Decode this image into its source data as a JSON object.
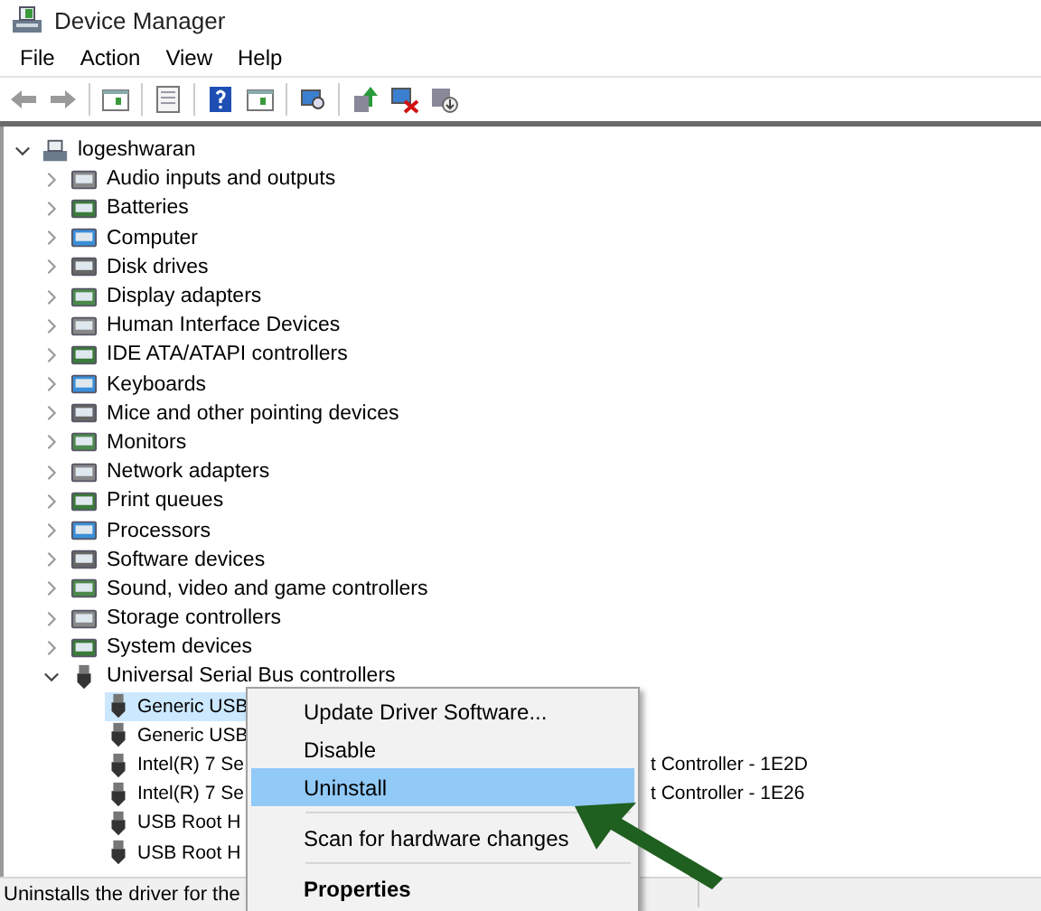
{
  "window": {
    "title": "Device Manager"
  },
  "menu_bar": [
    "File",
    "Action",
    "View",
    "Help"
  ],
  "tree": {
    "label": "logeshwaran",
    "expanded": true,
    "children": [
      {
        "label": "Audio inputs and outputs",
        "expanded": false
      },
      {
        "label": "Batteries",
        "expanded": false
      },
      {
        "label": "Computer",
        "expanded": false
      },
      {
        "label": "Disk drives",
        "expanded": false
      },
      {
        "label": "Display adapters",
        "expanded": false
      },
      {
        "label": "Human Interface Devices",
        "expanded": false
      },
      {
        "label": "IDE ATA/ATAPI controllers",
        "expanded": false
      },
      {
        "label": "Keyboards",
        "expanded": false
      },
      {
        "label": "Mice and other pointing devices",
        "expanded": false
      },
      {
        "label": "Monitors",
        "expanded": false
      },
      {
        "label": "Network adapters",
        "expanded": false
      },
      {
        "label": "Print queues",
        "expanded": false
      },
      {
        "label": "Processors",
        "expanded": false
      },
      {
        "label": "Software devices",
        "expanded": false
      },
      {
        "label": "Sound, video and game controllers",
        "expanded": false
      },
      {
        "label": "Storage controllers",
        "expanded": false
      },
      {
        "label": "System devices",
        "expanded": false
      },
      {
        "label": "Universal Serial Bus controllers",
        "expanded": true,
        "children": [
          {
            "label": "Generic USB",
            "selected": true
          },
          {
            "label": "Generic USB",
            "selected": false
          },
          {
            "label": "Intel(R) 7 Se",
            "label_after_menu": "t Controller - 1E2D",
            "selected": false
          },
          {
            "label": "Intel(R) 7 Se",
            "label_after_menu": "t Controller - 1E26",
            "selected": false
          },
          {
            "label": "USB Root H",
            "selected": false
          },
          {
            "label": "USB Root H",
            "selected": false
          }
        ]
      }
    ]
  },
  "context_menu": [
    {
      "kind": "item",
      "label": "Update Driver Software...",
      "selected": false,
      "default": false
    },
    {
      "kind": "item",
      "label": "Disable",
      "selected": false,
      "default": false
    },
    {
      "kind": "item",
      "label": "Uninstall",
      "selected": true,
      "default": false
    },
    {
      "kind": "separator"
    },
    {
      "kind": "item",
      "label": "Scan for hardware changes",
      "selected": false,
      "default": false
    },
    {
      "kind": "separator"
    },
    {
      "kind": "item",
      "label": "Properties",
      "selected": false,
      "default": true
    }
  ],
  "status_bar": "Uninstalls the driver for the"
}
